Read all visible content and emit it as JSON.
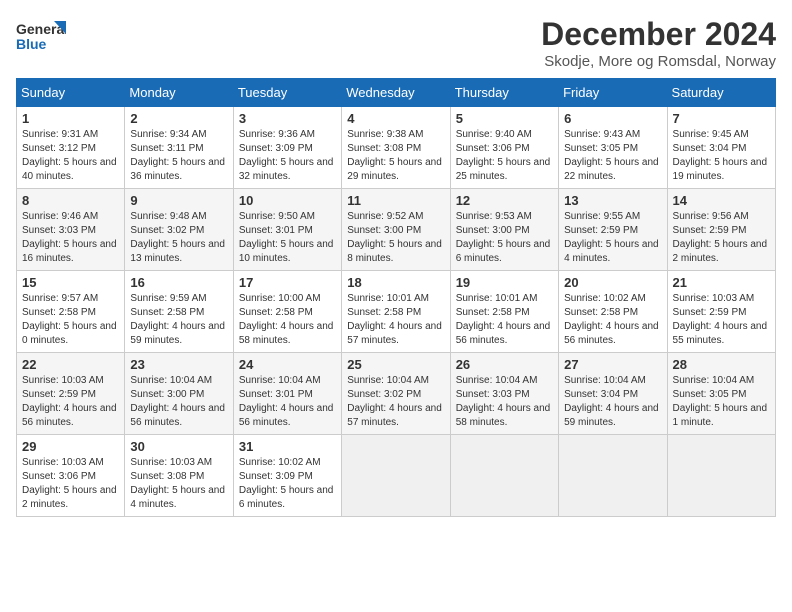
{
  "header": {
    "logo_line1": "General",
    "logo_line2": "Blue",
    "month_title": "December 2024",
    "location": "Skodje, More og Romsdal, Norway"
  },
  "weekdays": [
    "Sunday",
    "Monday",
    "Tuesday",
    "Wednesday",
    "Thursday",
    "Friday",
    "Saturday"
  ],
  "weeks": [
    [
      {
        "day": "1",
        "sunrise": "9:31 AM",
        "sunset": "3:12 PM",
        "daylight": "5 hours and 40 minutes."
      },
      {
        "day": "2",
        "sunrise": "9:34 AM",
        "sunset": "3:11 PM",
        "daylight": "5 hours and 36 minutes."
      },
      {
        "day": "3",
        "sunrise": "9:36 AM",
        "sunset": "3:09 PM",
        "daylight": "5 hours and 32 minutes."
      },
      {
        "day": "4",
        "sunrise": "9:38 AM",
        "sunset": "3:08 PM",
        "daylight": "5 hours and 29 minutes."
      },
      {
        "day": "5",
        "sunrise": "9:40 AM",
        "sunset": "3:06 PM",
        "daylight": "5 hours and 25 minutes."
      },
      {
        "day": "6",
        "sunrise": "9:43 AM",
        "sunset": "3:05 PM",
        "daylight": "5 hours and 22 minutes."
      },
      {
        "day": "7",
        "sunrise": "9:45 AM",
        "sunset": "3:04 PM",
        "daylight": "5 hours and 19 minutes."
      }
    ],
    [
      {
        "day": "8",
        "sunrise": "9:46 AM",
        "sunset": "3:03 PM",
        "daylight": "5 hours and 16 minutes."
      },
      {
        "day": "9",
        "sunrise": "9:48 AM",
        "sunset": "3:02 PM",
        "daylight": "5 hours and 13 minutes."
      },
      {
        "day": "10",
        "sunrise": "9:50 AM",
        "sunset": "3:01 PM",
        "daylight": "5 hours and 10 minutes."
      },
      {
        "day": "11",
        "sunrise": "9:52 AM",
        "sunset": "3:00 PM",
        "daylight": "5 hours and 8 minutes."
      },
      {
        "day": "12",
        "sunrise": "9:53 AM",
        "sunset": "3:00 PM",
        "daylight": "5 hours and 6 minutes."
      },
      {
        "day": "13",
        "sunrise": "9:55 AM",
        "sunset": "2:59 PM",
        "daylight": "5 hours and 4 minutes."
      },
      {
        "day": "14",
        "sunrise": "9:56 AM",
        "sunset": "2:59 PM",
        "daylight": "5 hours and 2 minutes."
      }
    ],
    [
      {
        "day": "15",
        "sunrise": "9:57 AM",
        "sunset": "2:58 PM",
        "daylight": "5 hours and 0 minutes."
      },
      {
        "day": "16",
        "sunrise": "9:59 AM",
        "sunset": "2:58 PM",
        "daylight": "4 hours and 59 minutes."
      },
      {
        "day": "17",
        "sunrise": "10:00 AM",
        "sunset": "2:58 PM",
        "daylight": "4 hours and 58 minutes."
      },
      {
        "day": "18",
        "sunrise": "10:01 AM",
        "sunset": "2:58 PM",
        "daylight": "4 hours and 57 minutes."
      },
      {
        "day": "19",
        "sunrise": "10:01 AM",
        "sunset": "2:58 PM",
        "daylight": "4 hours and 56 minutes."
      },
      {
        "day": "20",
        "sunrise": "10:02 AM",
        "sunset": "2:58 PM",
        "daylight": "4 hours and 56 minutes."
      },
      {
        "day": "21",
        "sunrise": "10:03 AM",
        "sunset": "2:59 PM",
        "daylight": "4 hours and 55 minutes."
      }
    ],
    [
      {
        "day": "22",
        "sunrise": "10:03 AM",
        "sunset": "2:59 PM",
        "daylight": "4 hours and 56 minutes."
      },
      {
        "day": "23",
        "sunrise": "10:04 AM",
        "sunset": "3:00 PM",
        "daylight": "4 hours and 56 minutes."
      },
      {
        "day": "24",
        "sunrise": "10:04 AM",
        "sunset": "3:01 PM",
        "daylight": "4 hours and 56 minutes."
      },
      {
        "day": "25",
        "sunrise": "10:04 AM",
        "sunset": "3:02 PM",
        "daylight": "4 hours and 57 minutes."
      },
      {
        "day": "26",
        "sunrise": "10:04 AM",
        "sunset": "3:03 PM",
        "daylight": "4 hours and 58 minutes."
      },
      {
        "day": "27",
        "sunrise": "10:04 AM",
        "sunset": "3:04 PM",
        "daylight": "4 hours and 59 minutes."
      },
      {
        "day": "28",
        "sunrise": "10:04 AM",
        "sunset": "3:05 PM",
        "daylight": "5 hours and 1 minute."
      }
    ],
    [
      {
        "day": "29",
        "sunrise": "10:03 AM",
        "sunset": "3:06 PM",
        "daylight": "5 hours and 2 minutes."
      },
      {
        "day": "30",
        "sunrise": "10:03 AM",
        "sunset": "3:08 PM",
        "daylight": "5 hours and 4 minutes."
      },
      {
        "day": "31",
        "sunrise": "10:02 AM",
        "sunset": "3:09 PM",
        "daylight": "5 hours and 6 minutes."
      },
      null,
      null,
      null,
      null
    ]
  ]
}
